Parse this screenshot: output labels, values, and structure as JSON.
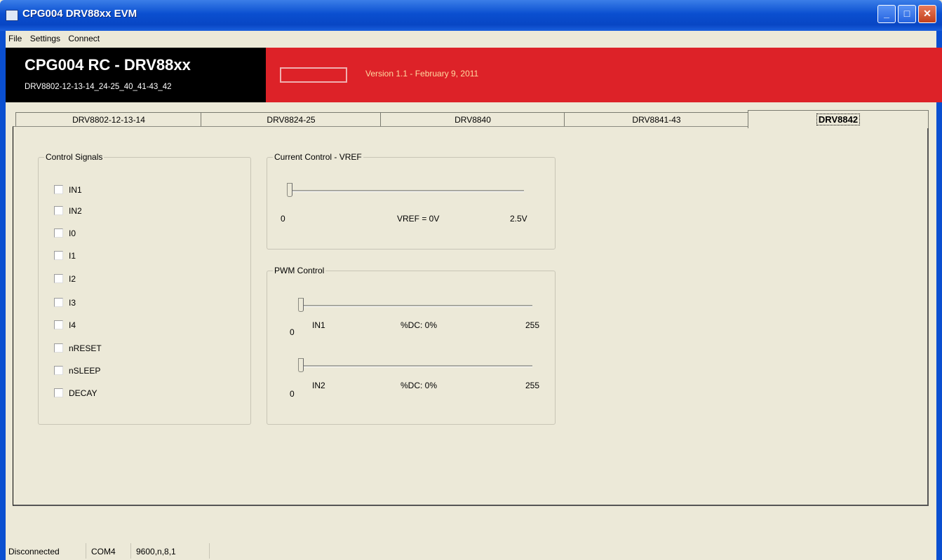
{
  "window": {
    "title": "CPG004 DRV88xx EVM",
    "min": "_",
    "max": "□",
    "close": "✕"
  },
  "menu": [
    "File",
    "Settings",
    "Connect"
  ],
  "brand": {
    "title": "CPG004 RC - DRV88xx",
    "subtitle": "DRV8802-12-13-14_24-25_40_41-43_42"
  },
  "version": "Version 1.1 - February 9, 2011",
  "tabs": [
    {
      "label": "DRV8802-12-13-14"
    },
    {
      "label": "DRV8824-25"
    },
    {
      "label": "DRV8840"
    },
    {
      "label": "DRV8841-43"
    },
    {
      "label": "DRV8842",
      "active": true
    }
  ],
  "control_signals": {
    "title": "Control Signals",
    "items": [
      "IN1",
      "IN2",
      "I0",
      "I1",
      "I2",
      "I3",
      "I4",
      "nRESET",
      "nSLEEP",
      "DECAY"
    ]
  },
  "current_control": {
    "title": "Current Control - VREF",
    "min": "0",
    "value_label": "VREF = 0V",
    "max": "2.5V",
    "level": 0
  },
  "pwm_control": {
    "title": "PWM Control",
    "sliders": [
      {
        "min": "0",
        "name": "IN1",
        "value_label": "%DC: 0%",
        "max": "255",
        "level": 0
      },
      {
        "min": "0",
        "name": "IN2",
        "value_label": "%DC: 0%",
        "max": "255",
        "level": 0
      }
    ]
  },
  "status": {
    "connection": "Disconnected",
    "port": "COM4",
    "settings": "9600,n,8,1"
  },
  "colors": {
    "title_bar": "#0a4fd0",
    "brand_black": "#000000",
    "header_red": "#dd2228",
    "panel": "#ece9d8"
  }
}
